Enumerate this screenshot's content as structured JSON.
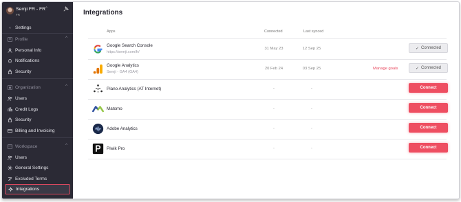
{
  "workspace": {
    "name": "Semji FR - FR",
    "sub": "FR"
  },
  "sidebar": {
    "back_label": "Settings",
    "sections": {
      "profile": "Profile",
      "organization": "Organization",
      "workspace": "Workspace"
    },
    "profile_items": [
      {
        "label": "Personal Info",
        "icon": "user-icon"
      },
      {
        "label": "Notifications",
        "icon": "bell-icon"
      },
      {
        "label": "Security",
        "icon": "lock-icon"
      }
    ],
    "organization_items": [
      {
        "label": "Users",
        "icon": "users-icon"
      },
      {
        "label": "Credit Logs",
        "icon": "credit-icon"
      },
      {
        "label": "Security",
        "icon": "lock-icon"
      },
      {
        "label": "Billing and Invoicing",
        "icon": "card-icon"
      }
    ],
    "workspace_items": [
      {
        "label": "Users",
        "icon": "users-icon"
      },
      {
        "label": "General Settings",
        "icon": "gear-icon"
      },
      {
        "label": "Excluded Terms",
        "icon": "excluded-icon"
      },
      {
        "label": "Integrations",
        "icon": "integrations-icon",
        "active": true
      }
    ]
  },
  "main": {
    "title": "Integrations",
    "columns": {
      "apps": "Apps",
      "connected": "Connected",
      "last_synced": "Last synced"
    },
    "rows": [
      {
        "name": "Google Search Console",
        "sub": "https://semji.com/fr/",
        "connected": "31 May 23",
        "synced": "12 Sep 25",
        "manage": "",
        "button": "Connected",
        "state": "connected",
        "logo": "google-logo"
      },
      {
        "name": "Google Analytics",
        "sub": "Semji - GA4 (GA4)",
        "connected": "20 Feb 24",
        "synced": "03 Sep 25",
        "manage": "Manage goals",
        "button": "Connected",
        "state": "connected",
        "logo": "google-analytics-logo"
      },
      {
        "name": "Piano Analytics (AT Internet)",
        "sub": "",
        "connected": "-",
        "synced": "-",
        "manage": "",
        "button": "Connect",
        "state": "connect",
        "logo": "piano-logo"
      },
      {
        "name": "Matomo",
        "sub": "",
        "connected": "-",
        "synced": "-",
        "manage": "",
        "button": "Connect",
        "state": "connect",
        "logo": "matomo-logo"
      },
      {
        "name": "Adobe Analytics",
        "sub": "",
        "connected": "-",
        "synced": "-",
        "manage": "",
        "button": "Connect",
        "state": "connect",
        "logo": "adobe-analytics-logo"
      },
      {
        "name": "Piwik Pro",
        "sub": "",
        "connected": "-",
        "synced": "-",
        "manage": "",
        "button": "Connect",
        "state": "connect",
        "logo": "piwik-pro-logo"
      }
    ]
  },
  "colors": {
    "sidebar_bg": "#2b2a35",
    "accent": "#ee4e61",
    "active_outline": "#d9485f"
  }
}
